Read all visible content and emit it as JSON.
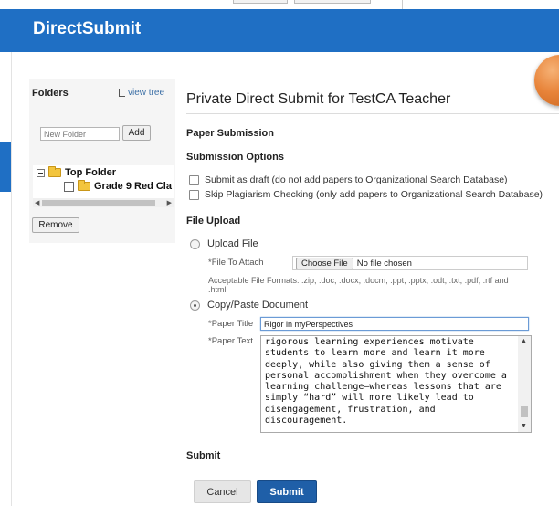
{
  "header": {
    "title": "DirectSubmit"
  },
  "folders": {
    "title": "Folders",
    "view_tree": "view tree",
    "new_folder_placeholder": "New Folder",
    "add_label": "Add",
    "tree": [
      {
        "label": "Top Folder"
      },
      {
        "label": "Grade 9 Red Cla"
      }
    ],
    "remove_label": "Remove"
  },
  "main": {
    "title": "Private Direct Submit for TestCA Teacher",
    "paper_submission": "Paper Submission",
    "submission_options": "Submission Options",
    "options": [
      {
        "label": "Submit as draft (do not add papers to Organizational Search Database)",
        "checked": false
      },
      {
        "label": "Skip Plagiarism Checking (only add papers to Organizational Search Database)",
        "checked": false
      }
    ],
    "file_upload": "File Upload",
    "upload_file_label": "Upload File",
    "file_to_attach_label": "*File To Attach",
    "choose_file_label": "Choose File",
    "no_file_label": "No file chosen",
    "acceptable_formats": "Acceptable File Formats: .zip, .doc, .docx, .docm, .ppt, .pptx, .odt, .txt, .pdf, .rtf and .html",
    "copy_paste_label": "Copy/Paste Document",
    "paper_title_label": "*Paper Title",
    "paper_title_value": "Rigor in myPerspectives",
    "paper_text_label": "*Paper Text",
    "paper_text_value": "rigorous learning experiences motivate students to learn more and learn it more deeply, while also giving them a sense of personal accomplishment when they overcome a learning challenge—whereas lessons that are simply “hard” will more likely lead to disengagement, frustration, and discouragement.",
    "submit_heading": "Submit",
    "cancel_label": "Cancel",
    "submit_label": "Submit"
  },
  "colors": {
    "header_bg": "#1f6fc4",
    "submit_bg": "#1f5fa8",
    "orb": "#e8843a"
  }
}
